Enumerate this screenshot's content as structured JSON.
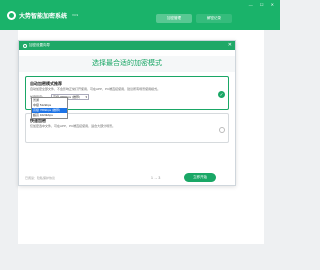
{
  "app": {
    "title": "大势智能加密系统",
    "version": "V3.9",
    "tabs": [
      "加密管理",
      "解密记录"
    ],
    "window_controls": [
      "—",
      "☐",
      "✕"
    ]
  },
  "modal": {
    "title": "加密设置向导",
    "close": "✕",
    "heading": "选择最合适的加密模式",
    "options": [
      {
        "title": "自动加密模式推荐",
        "desc": "自动加密全部文件，不会影响正常打开使用，可在APP、PC端直接使用，建议所有场景使用模式。",
        "select_label": "加密强度：",
        "select_value": "高级 768kbps (推荐)"
      },
      {
        "title": "快速加密",
        "desc": "仅加密选中文件，可在APP、PC端直接使用，适合大部分场景。"
      }
    ],
    "dropdown_options": [
      "普通",
      "中级 512kbps",
      "高级 768kbps (推荐)",
      "超高 1024kbps"
    ],
    "dropdown_selected_index": 2,
    "footer_note": "已阅读：隐私保护协议",
    "page_indicator": "1 → 3",
    "next_button": "立即开始"
  },
  "colors": {
    "accent": "#1ab36a",
    "selected": "#1e74e6"
  }
}
